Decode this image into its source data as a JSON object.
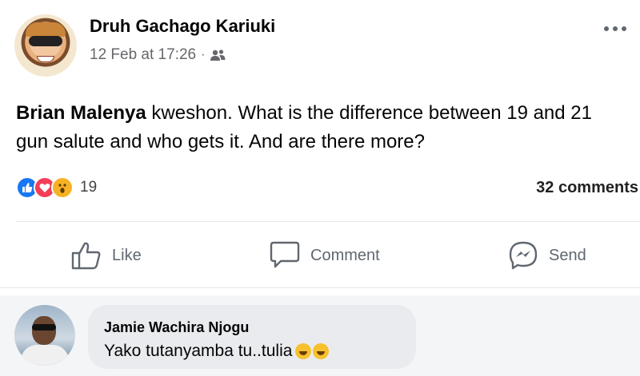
{
  "post": {
    "author": "Druh Gachago Kariuki",
    "timestamp": "12 Feb at 17:26",
    "separator": "·",
    "audience_icon": "friends-icon",
    "more_icon": "ellipsis-icon",
    "text_mention": "Brian Malenya",
    "text_body": " kweshon. What is the difference between 19 and 21 gun salute and who gets it. And are there more?"
  },
  "reactions": {
    "icons": [
      "like-icon",
      "love-icon",
      "wow-icon"
    ],
    "count": "19",
    "comments_label": "32 comments"
  },
  "actions": {
    "like_label": "Like",
    "comment_label": "Comment",
    "send_label": "Send"
  },
  "comment": {
    "author": "Jamie Wachira Njogu",
    "text": "Yako tutanyamba tu..tulia",
    "emojis": [
      "grinning-sweat-emoji",
      "grinning-sweat-emoji"
    ]
  },
  "colors": {
    "like": "#1877f2",
    "love": "#f33e58",
    "wow": "#f7b125",
    "meta_text": "#65676b"
  }
}
